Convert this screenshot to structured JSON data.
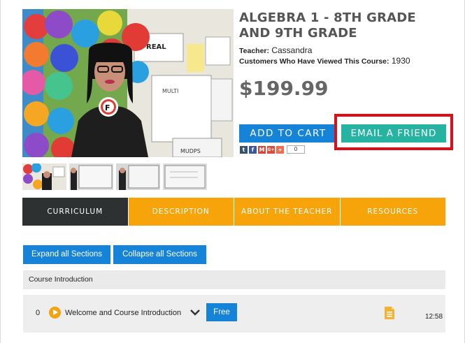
{
  "course": {
    "title": "ALGEBRA 1 - 8TH GRADE AND 9TH GRADE",
    "teacher_label": "Teacher:",
    "teacher_name": "Cassandra",
    "views_label": "Customers Who Have Viewed This Course:",
    "views_count": "1930",
    "price": "$199.99"
  },
  "hero": {
    "sign_texts": [
      "REAL",
      "MULTI",
      "MUDPS"
    ]
  },
  "actions": {
    "add_to_cart": "ADD TO CART",
    "email_friend": "EMAIL A FRIEND"
  },
  "share": {
    "icons": [
      "tumblr-icon",
      "facebook-icon",
      "gmail-icon",
      "googleplus-icon",
      "addthis-icon"
    ],
    "icon_glyphs": [
      "t",
      "f",
      "M",
      "G+",
      "+"
    ],
    "icon_colors": [
      "#34526f",
      "#3b5998",
      "#d44638",
      "#dd4b39",
      "#f8694d"
    ],
    "count": "0"
  },
  "tabs": [
    "CURRICULUM",
    "DESCRIPTION",
    "ABOUT THE TEACHER",
    "RESOURCES"
  ],
  "sections": {
    "expand_label": "Expand all Sections",
    "collapse_label": "Collapse all Sections",
    "section_title": "Course Introduction",
    "lesson": {
      "number": "0",
      "title": "Welcome and Course Introduction",
      "badge": "Free",
      "duration": "12:58"
    }
  },
  "colors": {
    "blue": "#1583d8",
    "teal": "#26b3a2",
    "orange": "#f7a40a",
    "dark_tab": "#2e3131",
    "highlight_red": "#e20d14"
  }
}
